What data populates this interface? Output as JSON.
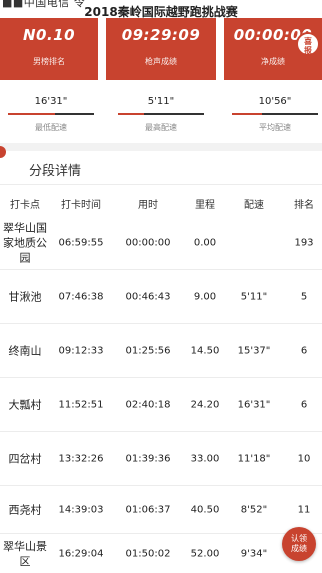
{
  "status_bar": {
    "carrier": "■■中国电信 令",
    "time": "■■■"
  },
  "nav": {
    "title": "2018秦岭国际越野跑挑战赛"
  },
  "summary_cards": [
    {
      "value": "N0.10",
      "label": "男榜排名"
    },
    {
      "value": "09:29:09",
      "label": "枪声成绩"
    },
    {
      "value": "00:00:00",
      "label": "净成绩"
    }
  ],
  "badge": {
    "text": "喜报"
  },
  "paces": [
    {
      "value": "16'31\"",
      "label": "最低配速",
      "fill_fraction": 0.55
    },
    {
      "value": "5'11\"",
      "label": "最高配速",
      "fill_fraction": 0.3
    },
    {
      "value": "10'56\"",
      "label": "平均配速",
      "fill_fraction": 0.35
    }
  ],
  "section": {
    "title": "分段详情"
  },
  "table": {
    "headers": [
      "打卡点",
      "打卡时间",
      "用时",
      "里程",
      "配速",
      "排名"
    ],
    "rows": [
      [
        "翠华山国家地质公园",
        "06:59:55",
        "00:00:00",
        "0.00",
        "",
        "193"
      ],
      [
        "甘湫池",
        "07:46:38",
        "00:46:43",
        "9.00",
        "5'11\"",
        "5"
      ],
      [
        "终南山",
        "09:12:33",
        "01:25:56",
        "14.50",
        "15'37\"",
        "6"
      ],
      [
        "大瓢村",
        "11:52:51",
        "02:40:18",
        "24.20",
        "16'31\"",
        "6"
      ],
      [
        "四岔村",
        "13:32:26",
        "01:39:36",
        "33.00",
        "11'18\"",
        "10"
      ],
      [
        "西尧村",
        "14:39:03",
        "01:06:37",
        "40.50",
        "8'52\"",
        "11"
      ],
      [
        "翠华山景区",
        "16:29:04",
        "01:50:02",
        "52.00",
        "9'34\"",
        ""
      ]
    ]
  },
  "fab": {
    "label": "认领成绩"
  },
  "colors": {
    "accent": "#c8432f",
    "divider": "#f2f2f2"
  }
}
